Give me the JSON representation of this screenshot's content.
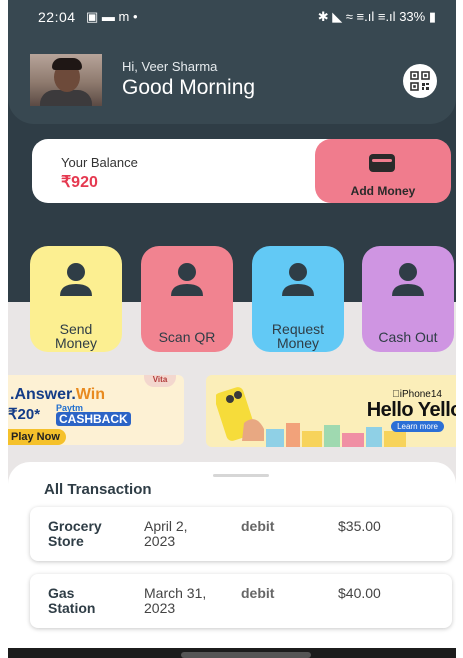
{
  "status_bar": {
    "time": "22:04",
    "left_icons": "▣ ▬ m •",
    "right_icons": "✱ ◣ ≈ ≡.ıl ≡.ıl",
    "battery": "33%"
  },
  "header": {
    "greeting_small": "Hi, Veer Sharma",
    "greeting_big": "Good Morning"
  },
  "balance": {
    "label": "Your Balance",
    "value": "₹920",
    "add_money_label": "Add Money"
  },
  "actions": [
    {
      "line1": "Send",
      "line2": "Money",
      "color": "#fcef91"
    },
    {
      "line1": "Scan  QR",
      "line2": "",
      "color": "#f18390"
    },
    {
      "line1": "Request",
      "line2": "Money",
      "color": "#62c9f5"
    },
    {
      "line1": "Cash Out",
      "line2": "",
      "color": "#cf95e2"
    }
  ],
  "banners": {
    "left": {
      "title_a": ".Answer.",
      "title_b": "Win",
      "line2": "₹20*",
      "paytm": "Paytm",
      "cashback": "CASHBACK",
      "cta": "Play Now",
      "badge": "Vita"
    },
    "right": {
      "model": "iPhone14",
      "headline": "Hello Yello",
      "cta": "Learn more"
    }
  },
  "transactions": {
    "title": "All Transaction",
    "rows": [
      {
        "name_1": "Grocery",
        "name_2": "Store",
        "date_1": "April 2,",
        "date_2": "2023",
        "type": "debit",
        "amount": "$35.00"
      },
      {
        "name_1": "Gas",
        "name_2": "Station",
        "date_1": "March 31,",
        "date_2": "2023",
        "type": "debit",
        "amount": "$40.00"
      }
    ]
  },
  "colors": {
    "header_bg": "#2f3d46",
    "accent_pink": "#e53950",
    "add_money_bg": "#f07c8d"
  }
}
